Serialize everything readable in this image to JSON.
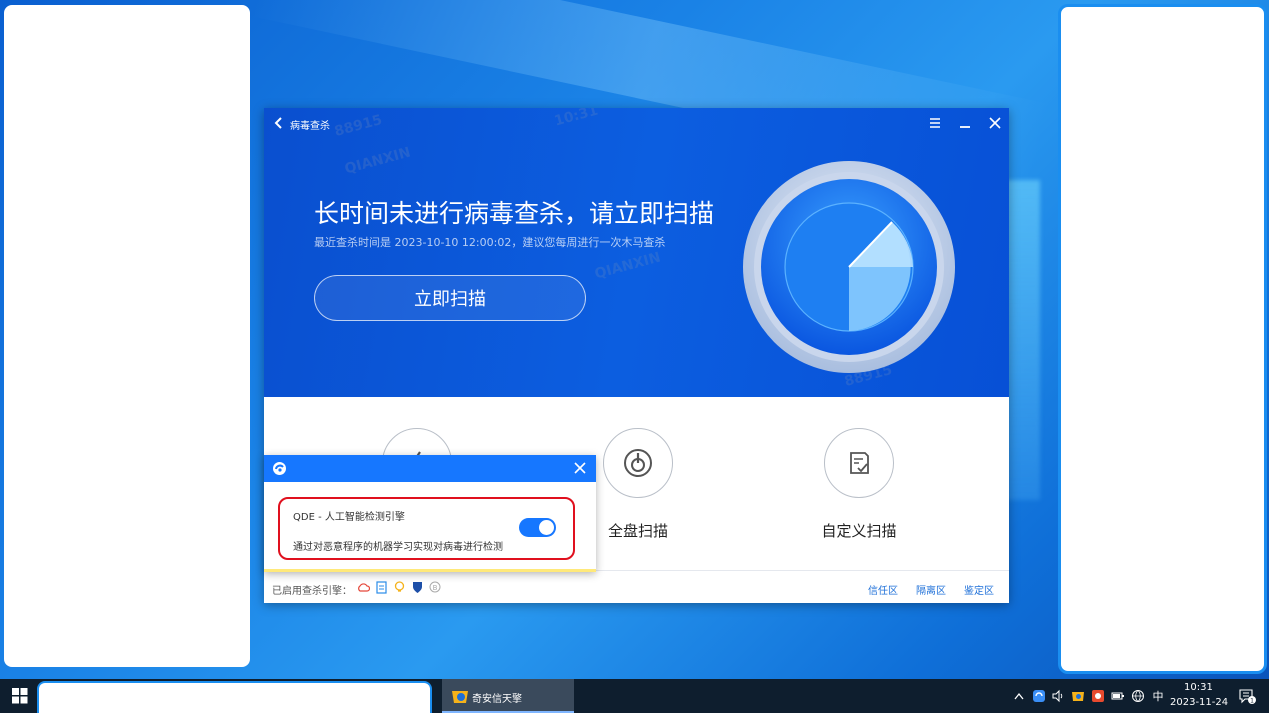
{
  "app": {
    "title": "病毒查杀",
    "headline": "长时间未进行病毒查杀，请立即扫描",
    "last_scan_text": "最近查杀时间是 2023-10-10 12:00:02，建议您每周进行一次木马查杀",
    "scan_button": "立即扫描",
    "modes": [
      {
        "label": "全盘扫描",
        "icon": "power-scan-icon"
      },
      {
        "label": "自定义扫描",
        "icon": "custom-check-icon"
      }
    ],
    "footer": {
      "engines_label": "已启用查杀引擎：",
      "links": [
        "信任区",
        "隔离区",
        "鉴定区"
      ]
    },
    "watermark": {
      "date": "2023-11-24",
      "time": "10:31",
      "brand": "QIANXIN",
      "id": "88915"
    }
  },
  "popup": {
    "engine_title": "QDE - 人工智能检测引擎",
    "engine_desc": "通过对恶意程序的机器学习实现对病毒进行检测",
    "toggle_on": true,
    "accent": "#1677ff",
    "highlight": "#e0101e"
  },
  "taskbar": {
    "app_label": "奇安信天擎",
    "ime": "中",
    "time": "10:31",
    "date": "2023-11-24",
    "notification_count": "1"
  }
}
